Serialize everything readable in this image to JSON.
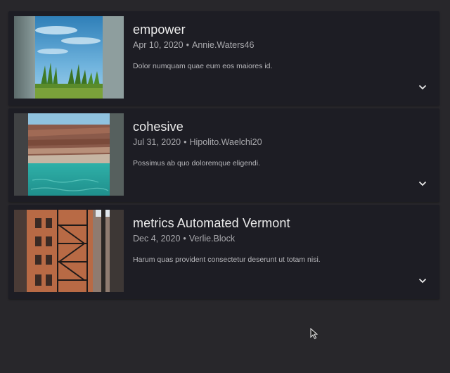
{
  "posts": [
    {
      "title": "empower",
      "date": "Apr 10, 2020",
      "separator": "•",
      "author": "Annie.Waters46",
      "description": "Dolor numquam quae eum eos maiores id.",
      "thumbnail": "grass-and-sky-photo",
      "expand_icon": "chevron-down-icon"
    },
    {
      "title": "cohesive",
      "date": "Jul 31, 2020",
      "separator": "•",
      "author": "Hipolito.Waelchi20",
      "description": "Possimus ab quo doloremque eligendi.",
      "thumbnail": "cliff-and-water-photo",
      "expand_icon": "chevron-down-icon"
    },
    {
      "title": "metrics Automated Vermont",
      "date": "Dec 4, 2020",
      "separator": "•",
      "author": "Verlie.Block",
      "description": "Harum quas provident consectetur deserunt ut totam nisi.",
      "thumbnail": "brick-building-fire-escape-photo",
      "expand_icon": "chevron-down-icon"
    }
  ],
  "colors": {
    "background": "#28272b",
    "card": "#1d1d24",
    "title": "#ececec",
    "meta": "#a9a9ad"
  }
}
